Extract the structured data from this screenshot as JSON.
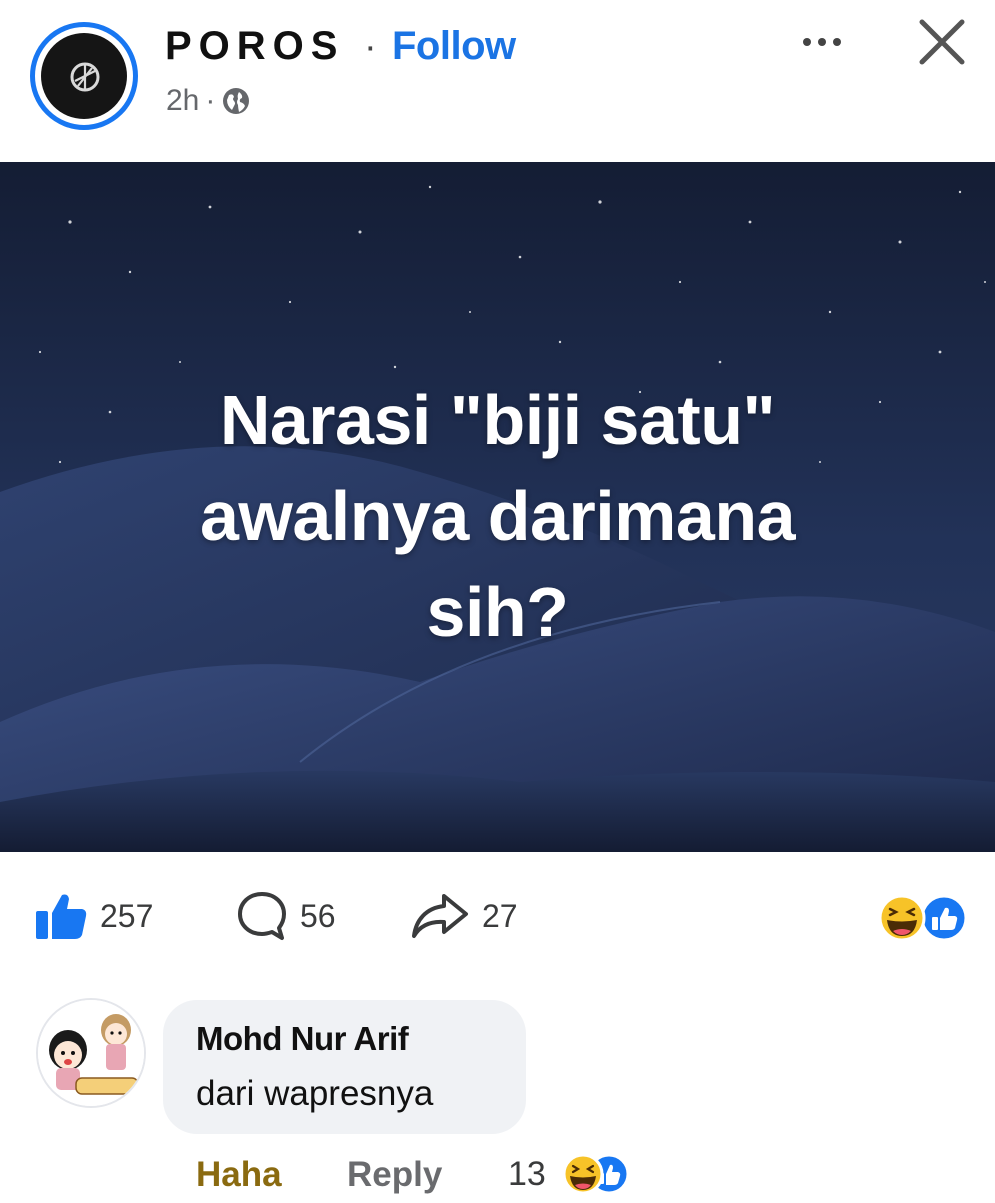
{
  "header": {
    "page_name": "POROS",
    "separator": "·",
    "follow_label": "Follow",
    "time": "2h",
    "time_separator": "·",
    "audience_icon": "globe-icon"
  },
  "post": {
    "text_lines": [
      "Narasi \"biji satu\"",
      "awalnya darimana",
      "sih?"
    ]
  },
  "stats": {
    "likes": "257",
    "comments": "56",
    "shares": "27",
    "reaction_icons": [
      "haha-reaction-icon",
      "like-reaction-icon"
    ]
  },
  "comment": {
    "author": "Mohd Nur Arif",
    "text": "dari wapresnya",
    "haha_label": "Haha",
    "reply_label": "Reply",
    "reaction_count": "13",
    "reaction_icons": [
      "haha-reaction-icon",
      "like-reaction-icon"
    ]
  },
  "colors": {
    "accent": "#1b74e4",
    "like_blue": "#1877f2",
    "haha_text": "#8a6a10",
    "image_bg": "#1d2a48"
  }
}
